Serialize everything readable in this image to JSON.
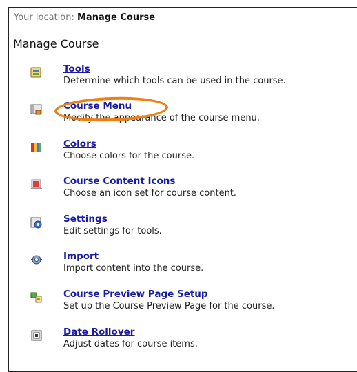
{
  "breadcrumb": {
    "prefix": "Your location:",
    "current": "Manage Course"
  },
  "heading": "Manage Course",
  "items": [
    {
      "label": "Tools",
      "description": "Determine which tools can be used in the course.",
      "icon": "tools-icon"
    },
    {
      "label": "Course Menu",
      "description": "Modify the appearance of the course menu.",
      "icon": "course-menu-icon"
    },
    {
      "label": "Colors",
      "description": "Choose colors for the course.",
      "icon": "colors-icon"
    },
    {
      "label": "Course Content Icons",
      "description": "Choose an icon set for course content.",
      "icon": "content-icons-icon"
    },
    {
      "label": "Settings",
      "description": "Edit settings for tools.",
      "icon": "settings-icon"
    },
    {
      "label": "Import",
      "description": "Import content into the course.",
      "icon": "import-icon"
    },
    {
      "label": "Course Preview Page Setup",
      "description": "Set up the Course Preview Page for the course.",
      "icon": "preview-page-icon"
    },
    {
      "label": "Date Rollover",
      "description": "Adjust dates for course items.",
      "icon": "date-rollover-icon"
    }
  ],
  "colors": {
    "link": "#1a1aa8",
    "highlight": "#ee7f12"
  }
}
